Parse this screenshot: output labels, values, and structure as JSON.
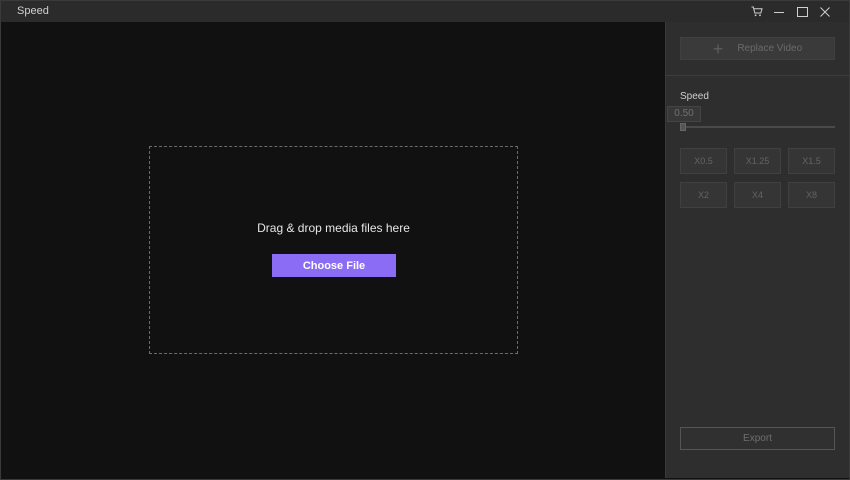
{
  "window": {
    "title": "Speed"
  },
  "main": {
    "drop_text": "Drag & drop media files here",
    "choose_label": "Choose File"
  },
  "panel": {
    "replace_label": "Replace Video",
    "speed_label": "Speed",
    "speed_value": "0.50",
    "speed_slider_fraction": 0.0,
    "presets": [
      "X0.5",
      "X1.25",
      "X1.5",
      "X2",
      "X4",
      "X8"
    ],
    "export_label": "Export"
  },
  "colors": {
    "accent": "#8b6cf5",
    "background": "#111111",
    "panel": "#2e2e2e"
  },
  "icons": {
    "titlebar": [
      "cart-icon",
      "minimize-icon",
      "maximize-icon",
      "close-icon"
    ],
    "replace": "plus-icon"
  }
}
